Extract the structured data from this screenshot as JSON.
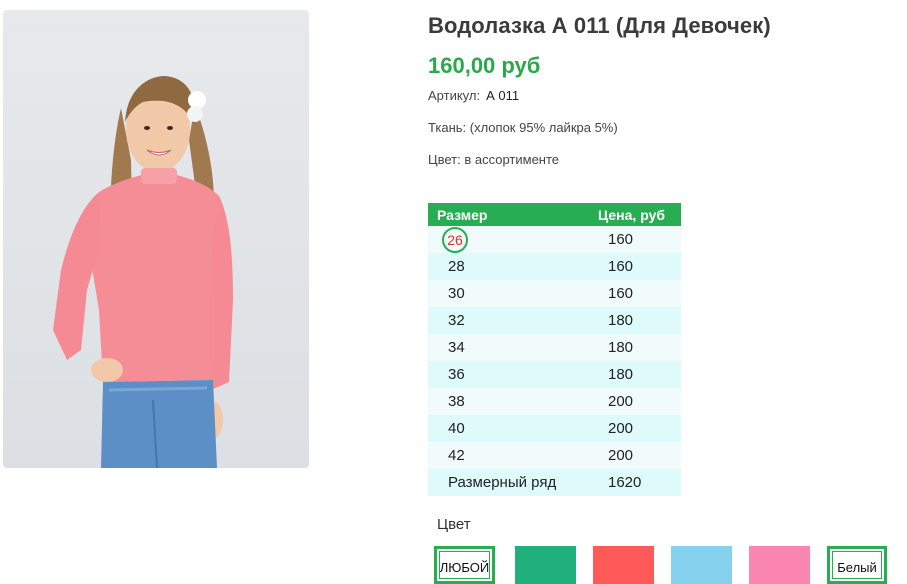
{
  "product": {
    "title": "Водолазка А 011 (Для Девочек)",
    "price": "160,00 руб",
    "sku_label": "Артикул:",
    "sku_value": "А 011",
    "fabric": "Ткань: (хлопок 95% лайкра 5%)",
    "color_note": "Цвет: в ассортименте"
  },
  "size_table": {
    "headers": [
      "Размер",
      "Цена, руб"
    ],
    "rows": [
      {
        "size": "26",
        "price": "160",
        "selected": true
      },
      {
        "size": "28",
        "price": "160"
      },
      {
        "size": "30",
        "price": "160"
      },
      {
        "size": "32",
        "price": "180"
      },
      {
        "size": "34",
        "price": "180"
      },
      {
        "size": "36",
        "price": "180"
      },
      {
        "size": "38",
        "price": "200"
      },
      {
        "size": "40",
        "price": "200"
      },
      {
        "size": "42",
        "price": "200"
      },
      {
        "size": "Размерный ряд",
        "price": "1620"
      }
    ]
  },
  "colors": {
    "label": "Цвет",
    "options": [
      {
        "label": "ЛЮБОЙ",
        "swatch": "#ffffff"
      },
      {
        "label": "",
        "swatch": "#1fb07e"
      },
      {
        "label": "",
        "swatch": "#ff5a5a"
      },
      {
        "label": "",
        "swatch": "#86d2ee"
      },
      {
        "label": "",
        "swatch": "#fb86b0"
      },
      {
        "label": "Белый",
        "swatch": "#ffffff"
      }
    ]
  },
  "palette": {
    "accent": "#27ae52",
    "selected_size": "#d93232",
    "row_light": "#f2fbfb",
    "row_tint": "#dffafa"
  }
}
